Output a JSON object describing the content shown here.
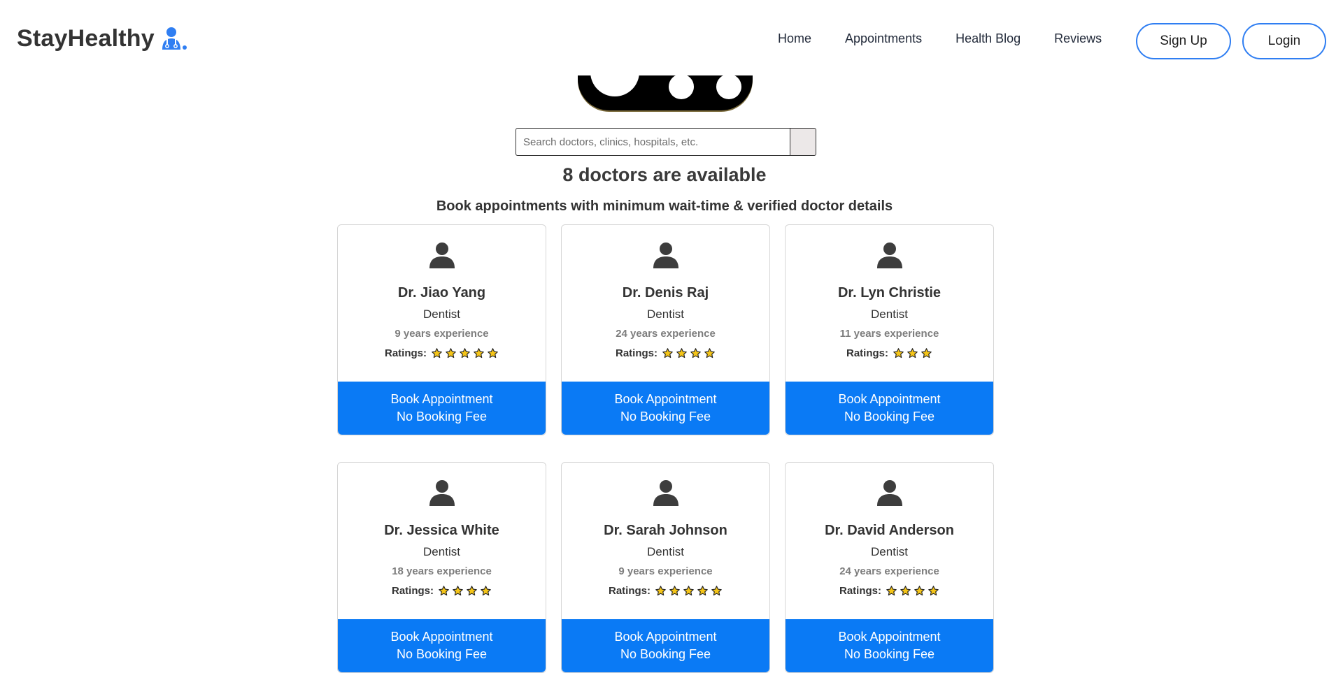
{
  "navbar": {
    "brand": "StayHealthy",
    "brand_icon": "doctor-icon",
    "links": [
      "Home",
      "Appointments",
      "Health Blog",
      "Reviews"
    ],
    "signup_label": "Sign Up",
    "login_label": "Login"
  },
  "search": {
    "placeholder": "Search doctors, clinics, hospitals, etc.",
    "button_icon": "search-icon"
  },
  "headline": "8 doctors are available",
  "subheadline": "Book appointments with minimum wait-time & verified doctor details",
  "doctors": [
    {
      "name": "Dr. Jiao Yang",
      "specialty": "Dentist",
      "experience": "9 years experience",
      "ratings_label": "Ratings:",
      "stars": 5,
      "book_line1": "Book Appointment",
      "book_line2": "No Booking Fee"
    },
    {
      "name": "Dr. Denis Raj",
      "specialty": "Dentist",
      "experience": "24 years experience",
      "ratings_label": "Ratings:",
      "stars": 4,
      "book_line1": "Book Appointment",
      "book_line2": "No Booking Fee"
    },
    {
      "name": "Dr. Lyn Christie",
      "specialty": "Dentist",
      "experience": "11 years experience",
      "ratings_label": "Ratings:",
      "stars": 3,
      "book_line1": "Book Appointment",
      "book_line2": "No Booking Fee"
    },
    {
      "name": "Dr. Jessica White",
      "specialty": "Dentist",
      "experience": "18 years experience",
      "ratings_label": "Ratings:",
      "stars": 4,
      "book_line1": "Book Appointment",
      "book_line2": "No Booking Fee"
    },
    {
      "name": "Dr. Sarah Johnson",
      "specialty": "Dentist",
      "experience": "9 years experience",
      "ratings_label": "Ratings:",
      "stars": 5,
      "book_line1": "Book Appointment",
      "book_line2": "No Booking Fee"
    },
    {
      "name": "Dr. David Anderson",
      "specialty": "Dentist",
      "experience": "24 years experience",
      "ratings_label": "Ratings:",
      "stars": 4,
      "book_line1": "Book Appointment",
      "book_line2": "No Booking Fee"
    }
  ],
  "colors": {
    "accent": "#0a7af5",
    "nav_border": "#2f7ef2",
    "star_fill": "#f5c518",
    "text": "#333333"
  }
}
